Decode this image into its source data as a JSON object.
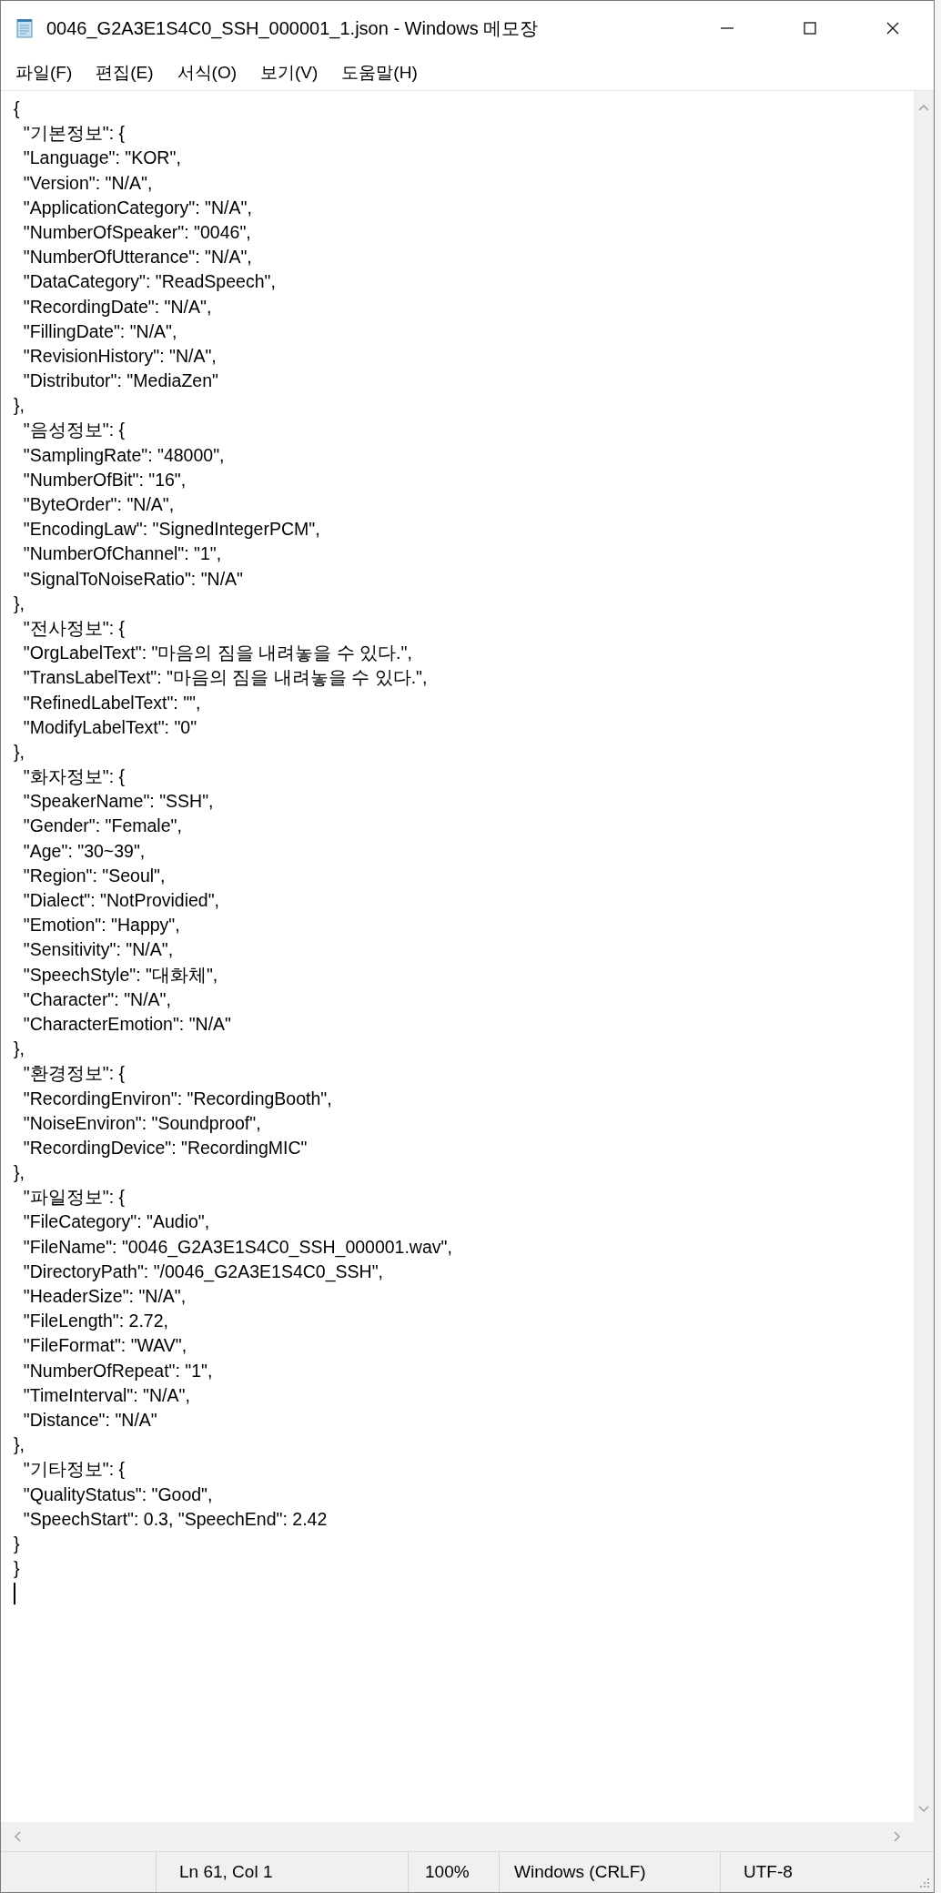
{
  "window": {
    "title": "0046_G2A3E1S4C0_SSH_000001_1.json - Windows 메모장"
  },
  "menu": [
    {
      "label": "파일(F)"
    },
    {
      "label": "편집(E)"
    },
    {
      "label": "서식(O)"
    },
    {
      "label": "보기(V)"
    },
    {
      "label": "도움말(H)"
    }
  ],
  "editor": {
    "lines": [
      "{",
      "  \"기본정보\": {",
      "  \"Language\": \"KOR\",",
      "  \"Version\": \"N/A\",",
      "  \"ApplicationCategory\": \"N/A\",",
      "  \"NumberOfSpeaker\": \"0046\",",
      "  \"NumberOfUtterance\": \"N/A\",",
      "  \"DataCategory\": \"ReadSpeech\",",
      "  \"RecordingDate\": \"N/A\",",
      "  \"FillingDate\": \"N/A\",",
      "  \"RevisionHistory\": \"N/A\",",
      "  \"Distributor\": \"MediaZen\"",
      "},",
      "  \"음성정보\": {",
      "  \"SamplingRate\": \"48000\",",
      "  \"NumberOfBit\": \"16\",",
      "  \"ByteOrder\": \"N/A\",",
      "  \"EncodingLaw\": \"SignedIntegerPCM\",",
      "  \"NumberOfChannel\": \"1\",",
      "  \"SignalToNoiseRatio\": \"N/A\"",
      "},",
      "  \"전사정보\": {",
      "  \"OrgLabelText\": \"마음의 짐을 내려놓을 수 있다.\",",
      "  \"TransLabelText\": \"마음의 짐을 내려놓을 수 있다.\",",
      "  \"RefinedLabelText\": \"\",",
      "  \"ModifyLabelText\": \"0\"",
      "},",
      "  \"화자정보\": {",
      "  \"SpeakerName\": \"SSH\",",
      "  \"Gender\": \"Female\",",
      "  \"Age\": \"30~39\",",
      "  \"Region\": \"Seoul\",",
      "  \"Dialect\": \"NotProvidied\",",
      "  \"Emotion\": \"Happy\",",
      "  \"Sensitivity\": \"N/A\",",
      "  \"SpeechStyle\": \"대화체\",",
      "  \"Character\": \"N/A\",",
      "  \"CharacterEmotion\": \"N/A\"",
      "},",
      "  \"환경정보\": {",
      "  \"RecordingEnviron\": \"RecordingBooth\",",
      "  \"NoiseEnviron\": \"Soundproof\",",
      "  \"RecordingDevice\": \"RecordingMIC\"",
      "},",
      "  \"파일정보\": {",
      "  \"FileCategory\": \"Audio\",",
      "  \"FileName\": \"0046_G2A3E1S4C0_SSH_000001.wav\",",
      "  \"DirectoryPath\": \"/0046_G2A3E1S4C0_SSH\",",
      "  \"HeaderSize\": \"N/A\",",
      "  \"FileLength\": 2.72,",
      "  \"FileFormat\": \"WAV\",",
      "  \"NumberOfRepeat\": \"1\",",
      "  \"TimeInterval\": \"N/A\",",
      "  \"Distance\": \"N/A\"",
      "},",
      "  \"기타정보\": {",
      "  \"QualityStatus\": \"Good\",",
      "  \"SpeechStart\": 0.3, \"SpeechEnd\": 2.42",
      "}",
      "}"
    ]
  },
  "status_bar": [
    {
      "text": "Ln 61, Col 1"
    },
    {
      "text": "100%"
    },
    {
      "text": "Windows (CRLF)"
    },
    {
      "text": "UTF-8"
    }
  ]
}
